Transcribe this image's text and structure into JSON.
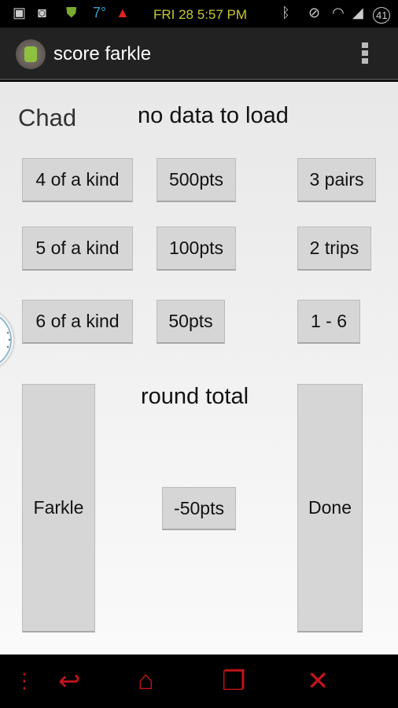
{
  "status_bar": {
    "temperature": "7°",
    "clock": "FRI 28 5:57 PM",
    "battery": "41"
  },
  "action_bar": {
    "title": "score farkle"
  },
  "main": {
    "player": "Chad",
    "message": "no data to load",
    "round_label": "round total",
    "buttons": {
      "four_kind": "4 of a kind",
      "five_kind": "5 of a kind",
      "six_kind": "6 of a kind",
      "p500": "500pts",
      "p100": "100pts",
      "p50": "50pts",
      "three_pairs": "3 pairs",
      "two_trips": "2 trips",
      "one_six": "1 - 6",
      "farkle": "Farkle",
      "minus50": "-50pts",
      "done": "Done"
    }
  },
  "colors": {
    "nav_accent": "#c0141a",
    "clock": "#c8c832"
  }
}
